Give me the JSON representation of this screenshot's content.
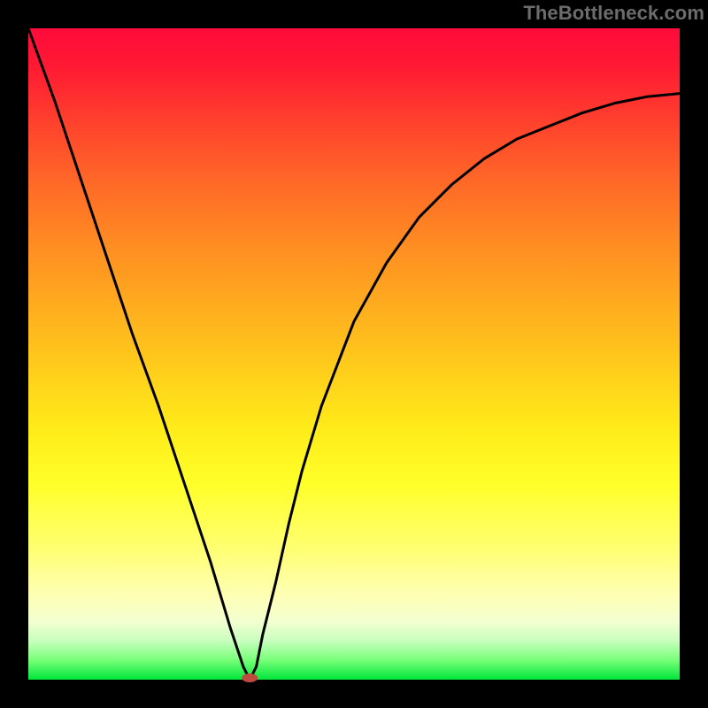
{
  "watermark": "TheBottleneck.com",
  "chart_data": {
    "type": "line",
    "title": "",
    "xlabel": "",
    "ylabel": "",
    "xlim": [
      0,
      100
    ],
    "ylim": [
      0,
      100
    ],
    "legend": false,
    "grid": false,
    "series": [
      {
        "name": "bottleneck-curve",
        "x": [
          0,
          4,
          8,
          12,
          16,
          20,
          24,
          28,
          31,
          33,
          34,
          35,
          36,
          38,
          40,
          42,
          45,
          50,
          55,
          60,
          65,
          70,
          75,
          80,
          85,
          90,
          95,
          100
        ],
        "y": [
          100,
          89,
          77,
          65,
          53,
          42,
          30,
          18,
          8,
          2,
          0,
          2,
          7,
          15,
          24,
          32,
          42,
          55,
          64,
          71,
          76,
          80,
          83,
          85,
          87,
          88.5,
          89.5,
          90
        ]
      }
    ],
    "marker": {
      "x": 34,
      "y": 0,
      "color": "#c04a40",
      "rx": 9,
      "ry": 5
    },
    "gradient_stops": [
      {
        "pos": 0.0,
        "color": "#ff0b3b"
      },
      {
        "pos": 0.2,
        "color": "#ff5a29"
      },
      {
        "pos": 0.45,
        "color": "#ffb61e"
      },
      {
        "pos": 0.68,
        "color": "#ffff2a"
      },
      {
        "pos": 0.9,
        "color": "#e8ffcc"
      },
      {
        "pos": 1.0,
        "color": "#00e63a"
      }
    ]
  }
}
